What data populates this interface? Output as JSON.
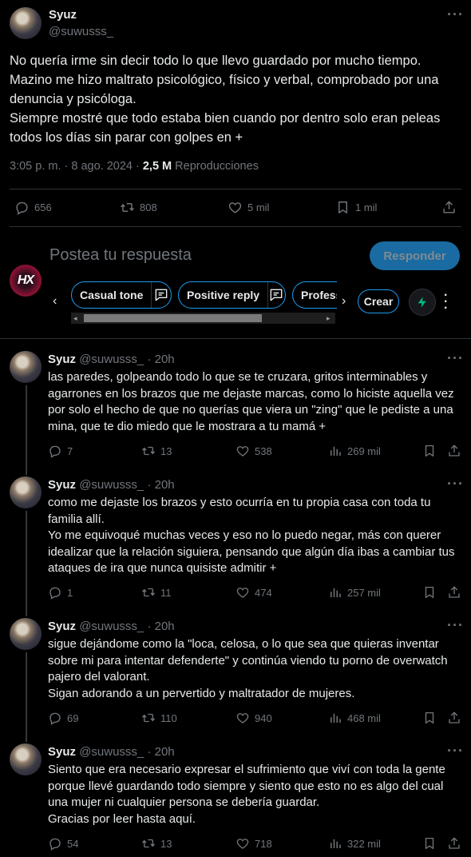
{
  "main_tweet": {
    "author_name": "Syuz",
    "author_handle": "@suwusss_",
    "text": "No quería irme sin decir todo lo que llevo guardado por mucho tiempo.\nMazino me hizo maltrato psicológico, físico y verbal, comprobado por una denuncia y psicóloga.\nSiempre mostré que todo estaba bien cuando por dentro solo eran peleas todos los días sin parar con golpes en +",
    "time": "3:05 p. m. · 8 ago. 2024 · ",
    "views_count": "2,5 M",
    "views_label": " Reproducciones",
    "replies": "656",
    "retweets": "808",
    "likes": "5 mil",
    "bookmarks": "1 mil"
  },
  "composer": {
    "placeholder": "Postea tu respuesta",
    "reply_button": "Responder",
    "chips": [
      "Casual tone",
      "Positive reply",
      "Profess"
    ],
    "create_button": "Crear"
  },
  "replies": [
    {
      "author_name": "Syuz",
      "author_handle": "@suwusss_",
      "time": "20h",
      "text": "las paredes, golpeando todo lo que se te cruzara, gritos interminables y agarrones en los brazos que me dejaste marcas, como lo hiciste aquella vez por solo el hecho de que no querías que viera un \"zing\" que le pediste a una mina, que te dio miedo que le mostrara a tu mamá +",
      "replies": "7",
      "retweets": "13",
      "likes": "538",
      "views": "269 mil"
    },
    {
      "author_name": "Syuz",
      "author_handle": "@suwusss_",
      "time": "20h",
      "text": "como me dejaste los brazos y esto ocurría en tu propia casa con toda tu familia allí.\nYo me equivoqué muchas veces y eso no lo puedo negar, más con querer idealizar que la relación siguiera, pensando que algún día ibas a cambiar tus ataques de ira que nunca quisiste admitir +",
      "replies": "1",
      "retweets": "11",
      "likes": "474",
      "views": "257 mil"
    },
    {
      "author_name": "Syuz",
      "author_handle": "@suwusss_",
      "time": "20h",
      "text": "sigue dejándome como la \"loca, celosa, o lo que sea que quieras inventar sobre mi para intentar defenderte\" y continúa viendo tu porno de overwatch pajero del valorant.\nSigan adorando a un pervertido y maltratador de mujeres.",
      "replies": "69",
      "retweets": "110",
      "likes": "940",
      "views": "468 mil"
    },
    {
      "author_name": "Syuz",
      "author_handle": "@suwusss_",
      "time": "20h",
      "text": "Siento que era necesario expresar el sufrimiento que viví con toda la gente porque llevé guardando todo siempre y siento que esto no es algo del cual una mujer ni cualquier persona se debería guardar.\nGracias por leer hasta aquí.",
      "replies": "54",
      "retweets": "13",
      "likes": "718",
      "views": "322 mil"
    }
  ],
  "colors": {
    "background": "#000000",
    "text": "#e7e9ea",
    "muted": "#71767b",
    "accent": "#1d9bf0",
    "divider": "#2f3336",
    "grok_green": "#00ba7c"
  }
}
